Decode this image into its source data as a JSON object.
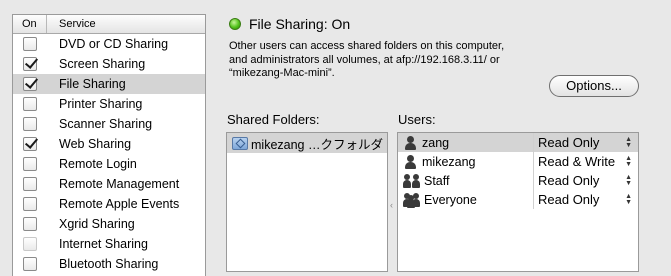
{
  "services": {
    "header": {
      "on": "On",
      "service": "Service"
    },
    "items": [
      {
        "label": "DVD or CD Sharing",
        "checked": false
      },
      {
        "label": "Screen Sharing",
        "checked": true
      },
      {
        "label": "File Sharing",
        "checked": true,
        "selected": true
      },
      {
        "label": "Printer Sharing",
        "checked": false
      },
      {
        "label": "Scanner Sharing",
        "checked": false
      },
      {
        "label": "Web Sharing",
        "checked": true
      },
      {
        "label": "Remote Login",
        "checked": false
      },
      {
        "label": "Remote Management",
        "checked": false
      },
      {
        "label": "Remote Apple Events",
        "checked": false
      },
      {
        "label": "Xgrid Sharing",
        "checked": false
      },
      {
        "label": "Internet Sharing",
        "checked": false,
        "disabled": true
      },
      {
        "label": "Bluetooth Sharing",
        "checked": false
      }
    ]
  },
  "status": {
    "title": "File Sharing: On",
    "indicator_color": "#52c21b",
    "description": "Other users can access shared folders on this computer,\nand administrators all volumes, at afp://192.168.3.11/ or\n“mikezang-Mac-mini”."
  },
  "options_button": "Options...",
  "shared_folders": {
    "label": "Shared Folders:",
    "items": [
      {
        "name": "mikezang …クフォルダ",
        "icon": "shared-folder-icon"
      }
    ]
  },
  "users": {
    "label": "Users:",
    "items": [
      {
        "name": "zang",
        "permission": "Read Only",
        "icon": "user-icon"
      },
      {
        "name": "mikezang",
        "permission": "Read & Write",
        "icon": "user-icon"
      },
      {
        "name": "Staff",
        "permission": "Read Only",
        "icon": "group-icon"
      },
      {
        "name": "Everyone",
        "permission": "Read Only",
        "icon": "everyone-icon"
      }
    ]
  },
  "splitter_glyph": "‹"
}
